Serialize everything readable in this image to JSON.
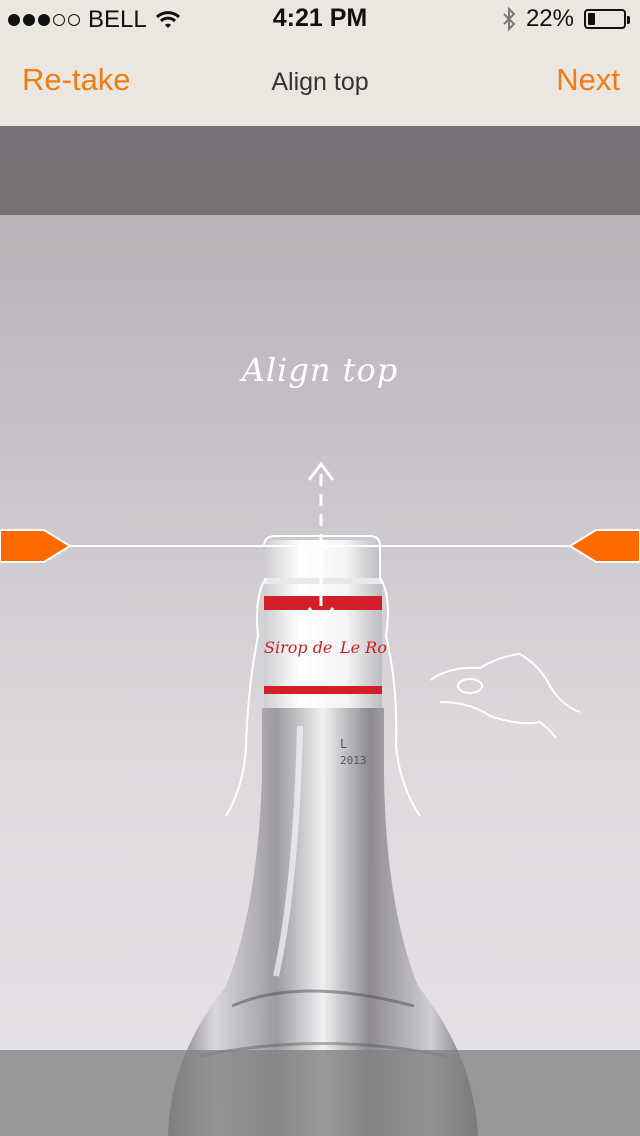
{
  "status_bar": {
    "carrier": "BELL",
    "time": "4:21 PM",
    "battery_percent": "22%",
    "battery_level": 0.22,
    "signal_bars_filled": 3,
    "signal_bars_total": 5
  },
  "nav": {
    "left_button": "Re-take",
    "title": "Align top",
    "right_button": "Next"
  },
  "overlay": {
    "instruction": "Align top"
  },
  "label_text": {
    "line1_left": "Sirop de",
    "line1_right": "Le Ro",
    "batch_line1": "L",
    "batch_line2": "2013"
  },
  "colors": {
    "accent": "#f07c13",
    "handle": "#ff6a00",
    "label_red": "#d2202a"
  }
}
